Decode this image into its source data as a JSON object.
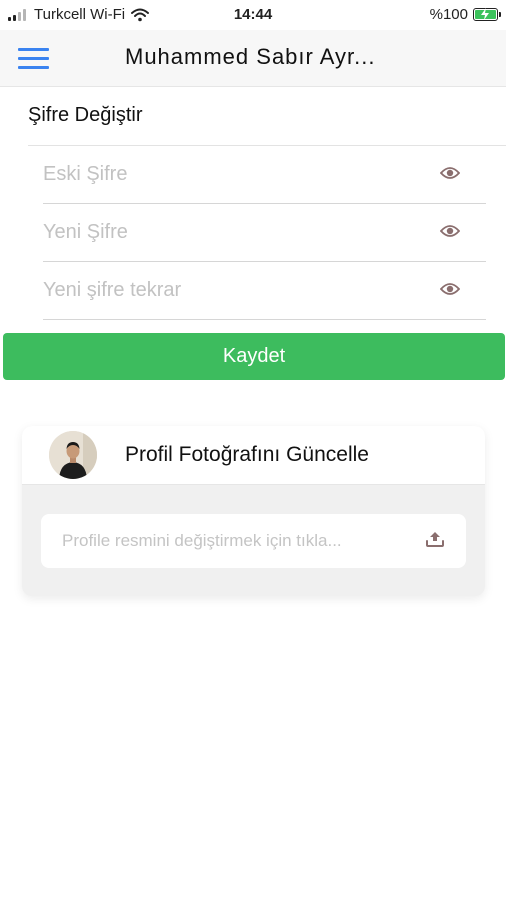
{
  "status_bar": {
    "carrier": "Turkcell Wi-Fi",
    "time": "14:44",
    "battery": "%100",
    "battery_level": 1.0
  },
  "header": {
    "title": "Muhammed Sabır Ayr...",
    "menu_icon": "hamburger-menu-icon"
  },
  "password_section": {
    "title": "Şifre Değiştir",
    "fields": [
      {
        "placeholder": "Eski Şifre",
        "value": "",
        "icon": "eye-icon"
      },
      {
        "placeholder": "Yeni Şifre",
        "value": "",
        "icon": "eye-icon"
      },
      {
        "placeholder": "Yeni şifre tekrar",
        "value": "",
        "icon": "eye-icon"
      }
    ],
    "save_label": "Kaydet"
  },
  "profile_photo": {
    "title": "Profil Fotoğrafını Güncelle",
    "upload_placeholder": "Profile resmini değiştirmek için tıkla...",
    "upload_icon": "upload-icon"
  },
  "colors": {
    "accent_blue": "#3a83f0",
    "save_green": "#3dbc5e",
    "eye_icon": "#8a6e6e"
  }
}
